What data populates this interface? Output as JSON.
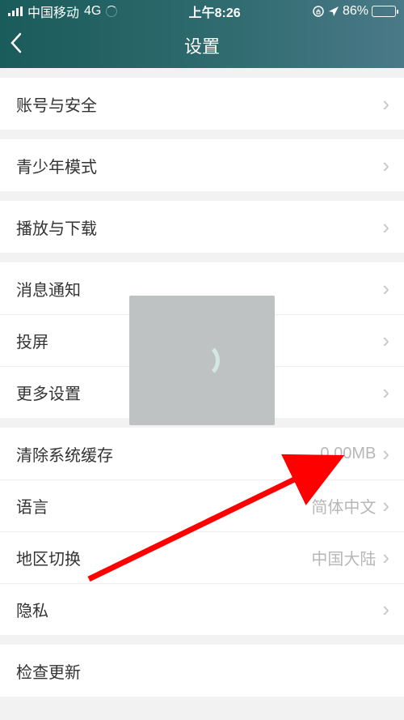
{
  "status": {
    "carrier": "中国移动",
    "network": "4G",
    "time": "上午8:26",
    "battery_pct": "86%"
  },
  "nav": {
    "title": "设置"
  },
  "rows": {
    "account": "账号与安全",
    "teen": "青少年模式",
    "play": "播放与下载",
    "notify": "消息通知",
    "cast": "投屏",
    "more": "更多设置",
    "cache": "清除系统缓存",
    "cache_value": "0.00MB",
    "lang": "语言",
    "lang_value": "简体中文",
    "region": "地区切换",
    "region_value": "中国大陆",
    "privacy": "隐私",
    "update": "检查更新"
  }
}
